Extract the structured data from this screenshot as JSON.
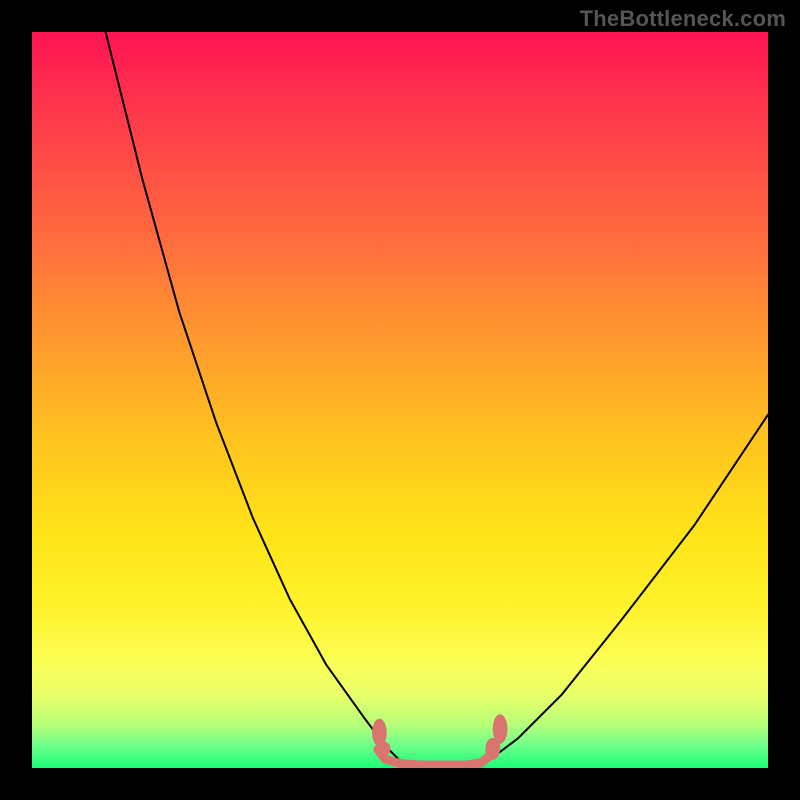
{
  "watermark": "TheBottleneck.com",
  "chart_data": {
    "type": "line",
    "title": "",
    "xlabel": "",
    "ylabel": "",
    "xlim": [
      0,
      100
    ],
    "ylim": [
      0,
      100
    ],
    "grid": false,
    "legend": false,
    "gradient_stops": [
      {
        "offset": 0,
        "color": "#ff1454"
      },
      {
        "offset": 12,
        "color": "#ff3b4a"
      },
      {
        "offset": 28,
        "color": "#ff6b3e"
      },
      {
        "offset": 42,
        "color": "#ff9a2e"
      },
      {
        "offset": 56,
        "color": "#ffc51e"
      },
      {
        "offset": 68,
        "color": "#ffe319"
      },
      {
        "offset": 78,
        "color": "#fff22a"
      },
      {
        "offset": 86,
        "color": "#fbff56"
      },
      {
        "offset": 90,
        "color": "#e8ff6a"
      },
      {
        "offset": 94,
        "color": "#b8ff78"
      },
      {
        "offset": 97,
        "color": "#6dff8a"
      },
      {
        "offset": 100,
        "color": "#18ff75"
      }
    ],
    "series": [
      {
        "name": "left-curve",
        "stroke": "#000000",
        "x": [
          10,
          15,
          20,
          25,
          30,
          35,
          40,
          45,
          48,
          50
        ],
        "y": [
          100,
          80,
          62,
          47,
          34,
          23,
          14,
          7,
          3,
          1
        ]
      },
      {
        "name": "right-curve",
        "stroke": "#000000",
        "x": [
          62,
          66,
          72,
          80,
          90,
          100
        ],
        "y": [
          1,
          4,
          10,
          20,
          33,
          48
        ]
      },
      {
        "name": "bottom-flat",
        "stroke": "#d9746e",
        "x": [
          47,
          48,
          50,
          53,
          56,
          59,
          61,
          62,
          63
        ],
        "y": [
          2.5,
          1.2,
          0.6,
          0.4,
          0.4,
          0.4,
          0.7,
          1.5,
          3
        ]
      }
    ],
    "markers": [
      {
        "name": "left-dot-1",
        "x": 47.2,
        "y": 4.8,
        "rx": 1.0,
        "ry": 1.9,
        "fill": "#d9746e"
      },
      {
        "name": "left-dot-2",
        "x": 47.8,
        "y": 2.6,
        "rx": 0.9,
        "ry": 1.0,
        "fill": "#d9746e"
      },
      {
        "name": "right-dot-1",
        "x": 62.6,
        "y": 2.6,
        "rx": 1.0,
        "ry": 1.5,
        "fill": "#d9746e"
      },
      {
        "name": "right-dot-2",
        "x": 63.6,
        "y": 5.3,
        "rx": 1.0,
        "ry": 2.0,
        "fill": "#d9746e"
      }
    ]
  }
}
